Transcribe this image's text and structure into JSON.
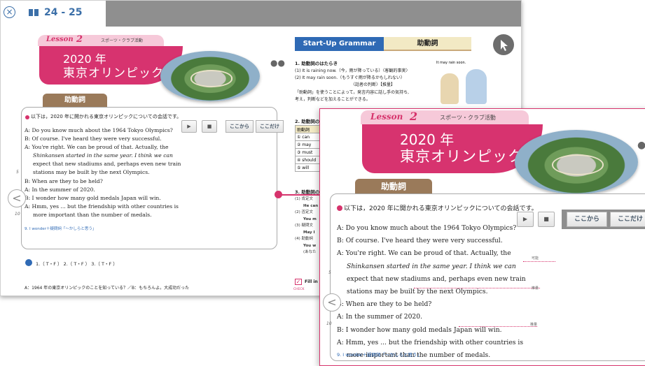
{
  "topbar": {
    "close_icon": "close-circle-icon",
    "page_range": "24 - 25"
  },
  "lesson": {
    "label": "Lesson",
    "number": "2",
    "subtitle": "スポーツ・クラブ活動",
    "title_line1": "2020 年",
    "title_line2": "東京オリンピック",
    "grammar_label": "助動詞"
  },
  "intro": "以下は，2020 年に開かれる東京オリンピックについての会話です。",
  "controls": {
    "play": "▶",
    "stop": "■",
    "from_here": "ここから",
    "only_here": "ここだけ"
  },
  "dialog": [
    "A: Do you know much about the 1964 Tokyo Olympics?",
    "B: Of course.  I've heard they were very successful.",
    "A: You're right.  We can be proud of that.  Actually, the",
    "Shinkansen started in the same year.  I think we can",
    "expect that new stadiums and, perhaps even new train",
    "stations may be built by the next Olympics.",
    "B: When are they to be held?",
    "A: In the summer of 2020.",
    "B: I wonder how many gold medals Japan will win.",
    "A: Hmm, yes ... but the friendship with other countries is",
    "more important than the number of medals."
  ],
  "line_numbers": [
    "5",
    "10"
  ],
  "notes": {
    "possible": "可能",
    "guess": "推量",
    "future": "推量"
  },
  "footnote": "9. I wonder＋疑問詞「～かしらと思う」",
  "quiz": "1.（ T・F ） 2.（ T・F ） 3.（ T・F ）",
  "translation": "A：1964 年の東京オリンピックのことを知っている？／B：もちろんよ。大成功だった",
  "startup": {
    "header": "Start-Up Grammar",
    "tab": "助動詞",
    "section1_title": "1. 助動詞のはたらき",
    "s1_line1": "(1) It is raining now.（今，雨が降っている）〈客観的事実〉",
    "s1_line2": "(2) It may rain soon.（もうすぐ雨が降るかもしれない）",
    "s1_line3": "〈話者の判断〉【推量】",
    "s1_line4": "「助動詞」を使うことによって，発言内容に話し手の気持ち,",
    "s1_line5": "考え，判断などを加えることができる。",
    "cartoon_text": "It may rain soon.",
    "section2_title": "2. 助動詞の",
    "table_header": "助動詞",
    "table_rows": [
      "① can",
      "② may",
      "③ must",
      "④ should",
      "⑤ will"
    ],
    "section3_title": "3. 助動詞の",
    "s3_lines": [
      "(1) 肯定文",
      "He can",
      "(2) 否定文",
      "You m",
      "(3) 疑問文",
      "May I",
      "(4) 助動詞",
      "You w",
      "(あなた"
    ],
    "check_label": "CHECK",
    "fill_label": "Fill in"
  },
  "colors": {
    "accent": "#d6336c",
    "blue": "#2f6ab5",
    "brown": "#9a7a5a"
  }
}
